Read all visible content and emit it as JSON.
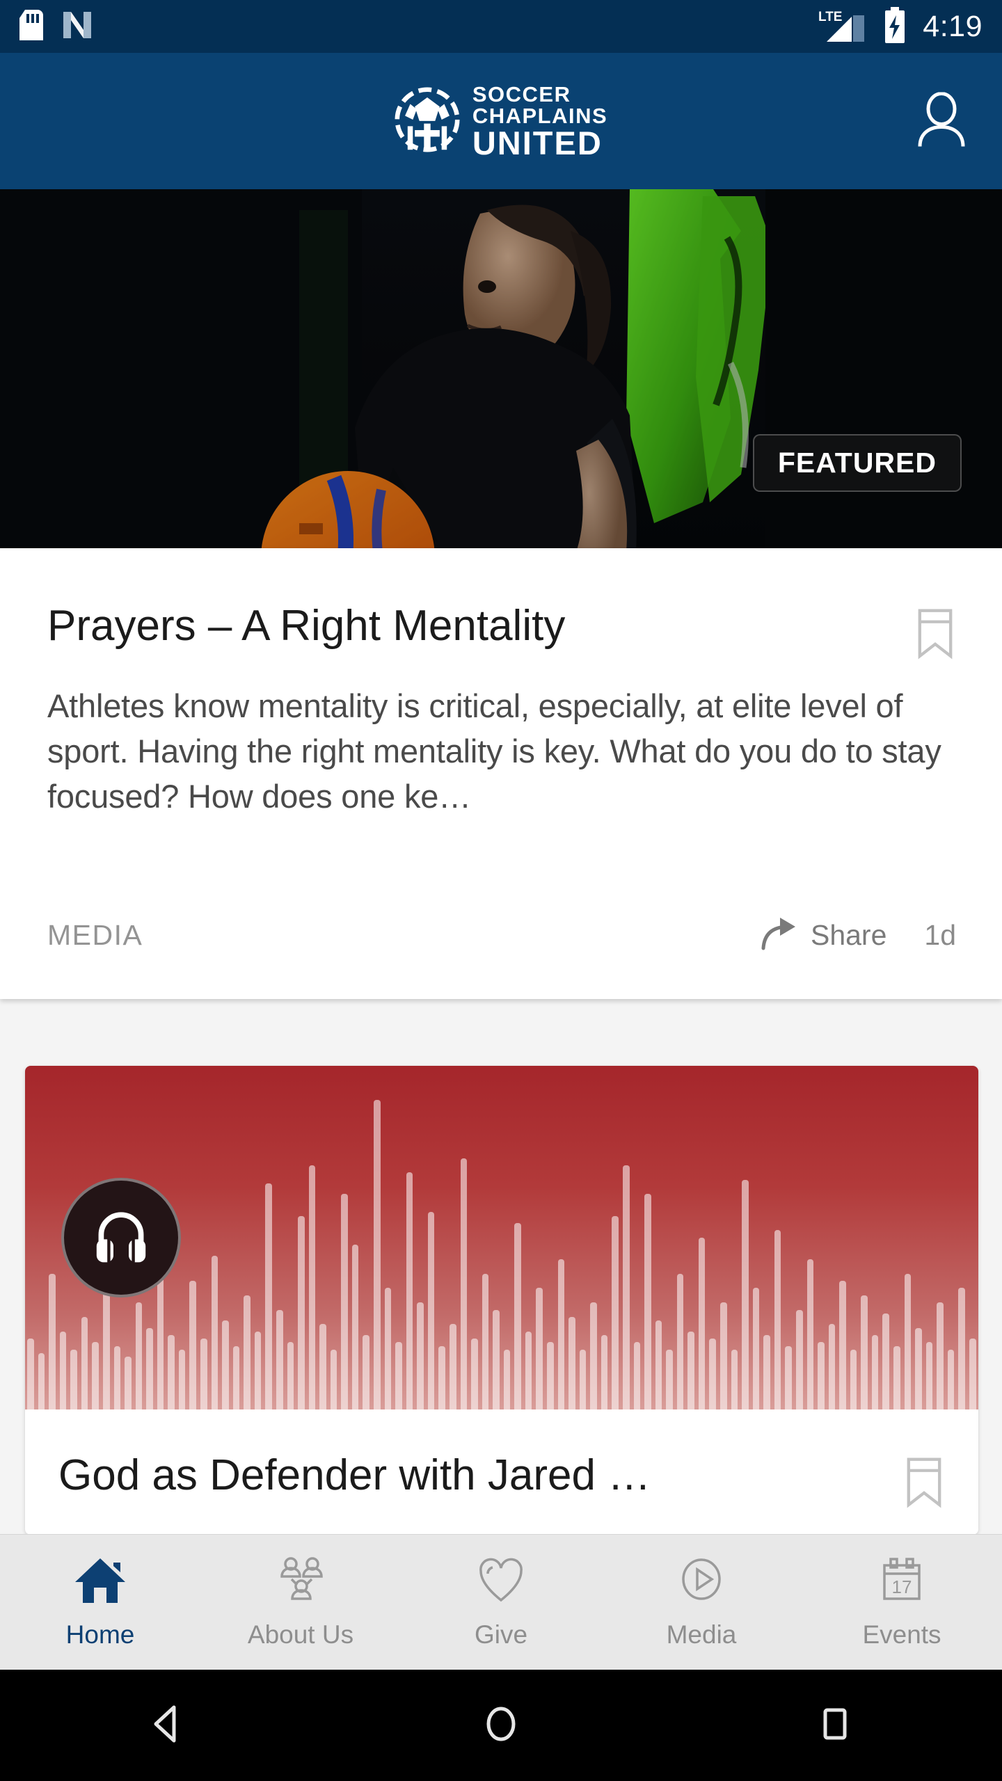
{
  "status_bar": {
    "time": "4:19",
    "network_label": "LTE",
    "icons": [
      "sd-card-icon",
      "nfc-icon",
      "lte-signal-icon",
      "battery-charging-icon"
    ],
    "background_color": "#042f54"
  },
  "app_header": {
    "logo_line1": "SOCCER",
    "logo_line2": "CHAPLAINS",
    "logo_line3": "UNITED",
    "logo_icon": "soccer-ball-cross-icon",
    "profile_icon": "person-icon",
    "background_color": "#0a4272"
  },
  "hero": {
    "badge_label": "FEATURED",
    "play_icon": "headphones-icon",
    "image_description": "dark locker room, athlete kneeling with orange soccer ball"
  },
  "feature_card": {
    "title": "Prayers – A Right Mentality",
    "excerpt": "Athletes know mentality is critical, especially, at elite level of sport. Having the right mentality is key. What do you do to stay focused? How does one ke…",
    "category": "MEDIA",
    "share_label": "Share",
    "share_icon": "share-arrow-icon",
    "age": "1d",
    "bookmark_icon": "bookmark-icon"
  },
  "audio_card": {
    "title": "God as Defender with Jared …",
    "play_icon": "headphones-icon",
    "bookmark_icon": "bookmark-icon",
    "artwork_color_top": "#a5262b",
    "artwork_color_bottom": "#d99d99",
    "waveform": [
      12,
      8,
      30,
      14,
      9,
      18,
      11,
      26,
      10,
      7,
      22,
      15,
      40,
      13,
      9,
      28,
      12,
      35,
      17,
      10,
      24,
      14,
      55,
      20,
      11,
      46,
      60,
      16,
      9,
      52,
      38,
      13,
      78,
      26,
      11,
      58,
      22,
      47,
      10,
      16,
      62,
      12,
      30,
      20,
      9,
      44,
      14,
      26,
      11,
      34,
      18,
      9,
      22,
      13,
      46,
      60,
      11,
      52,
      17,
      9,
      30,
      14,
      40,
      12,
      22,
      9,
      56,
      26,
      13,
      42,
      10,
      20,
      34,
      11,
      16,
      28,
      9,
      24,
      13,
      19,
      10,
      30,
      15,
      11,
      22,
      9,
      26,
      12
    ]
  },
  "bottom_nav": {
    "items": [
      {
        "label": "Home",
        "icon": "home-icon",
        "active": true
      },
      {
        "label": "About Us",
        "icon": "people-group-icon",
        "active": false
      },
      {
        "label": "Give",
        "icon": "heart-icon",
        "active": false
      },
      {
        "label": "Media",
        "icon": "play-circle-icon",
        "active": false
      },
      {
        "label": "Events",
        "icon": "calendar-17-icon",
        "active": false
      }
    ],
    "active_color": "#0d4073",
    "inactive_color": "#8e8e8e",
    "background_color": "#e8e8e8"
  },
  "system_nav": {
    "back_icon": "triangle-back-icon",
    "home_icon": "circle-home-icon",
    "recents_icon": "square-recents-icon"
  }
}
